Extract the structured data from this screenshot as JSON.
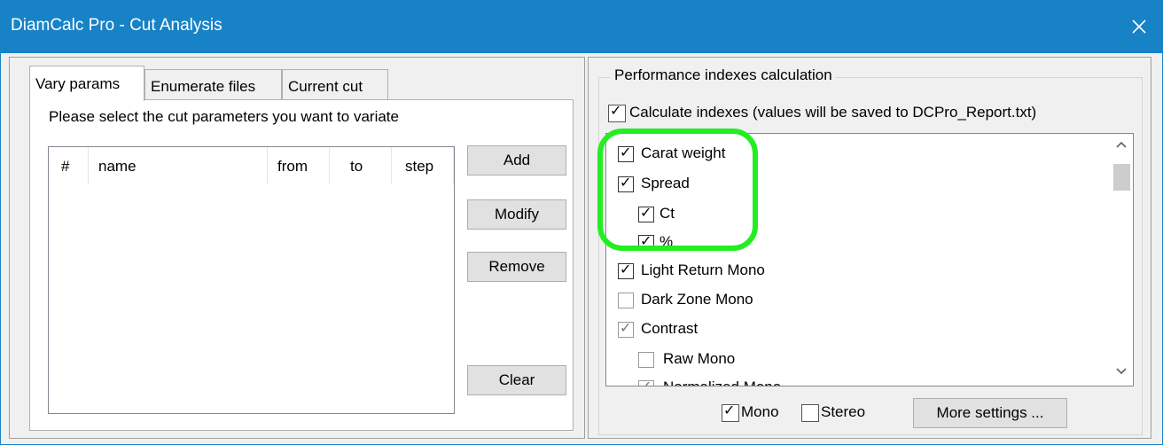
{
  "window": {
    "title": "DiamCalc Pro - Cut Analysis",
    "close_label": "✕"
  },
  "tabs": [
    {
      "label": "Vary params"
    },
    {
      "label": "Enumerate files"
    },
    {
      "label": "Current cut"
    }
  ],
  "vary": {
    "instruction": "Please select the cut parameters you want to variate",
    "columns": [
      "#",
      "name",
      "from",
      "to",
      "step"
    ],
    "buttons": {
      "add": "Add",
      "modify": "Modify",
      "remove": "Remove",
      "clear": "Clear"
    }
  },
  "performance": {
    "group_title": "Performance indexes calculation",
    "calculate_label": "Calculate indexes (values will be saved to DCPro_Report.txt)",
    "calculate_checked": true,
    "indexes": [
      {
        "label": "Carat weight",
        "checked": true,
        "indent": 0
      },
      {
        "label": "Spread",
        "checked": true,
        "indent": 0
      },
      {
        "label": "Ct",
        "checked": true,
        "indent": 1
      },
      {
        "label": "%",
        "checked": true,
        "indent": 1
      },
      {
        "label": "Light Return Mono",
        "checked": true,
        "indent": 0
      },
      {
        "label": "Dark Zone Mono",
        "checked": false,
        "indent": 0
      },
      {
        "label": "Contrast",
        "checked": true,
        "indent": 0,
        "partial": true
      },
      {
        "label": "Raw Mono",
        "checked": false,
        "indent": 1
      },
      {
        "label": "Normalized Mono",
        "checked": true,
        "indent": 1,
        "partial": true
      }
    ],
    "mono_label": "Mono",
    "mono_checked": true,
    "stereo_label": "Stereo",
    "stereo_checked": false,
    "more_settings_label": "More settings ..."
  },
  "colors": {
    "titlebar": "#1882c6",
    "highlight": "#22ee22"
  }
}
